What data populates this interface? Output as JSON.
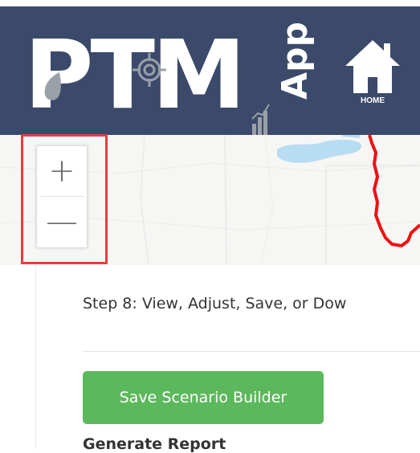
{
  "header": {
    "logo_letters": "PTM",
    "logo_suffix": "App",
    "home_label": "HOME"
  },
  "map": {
    "zoom_in_label": "+",
    "zoom_out_label": "—"
  },
  "panel": {
    "step_title": "Step 8: View, Adjust, Save, or Dow",
    "save_button_label": "Save Scenario Builder",
    "next_heading": "Generate Report"
  },
  "colors": {
    "header_bg": "#3b4a6b",
    "highlight_border": "#e0403c",
    "save_button": "#5cb85c",
    "watershed_line": "#ee1111",
    "water": "#b8dcf2"
  }
}
